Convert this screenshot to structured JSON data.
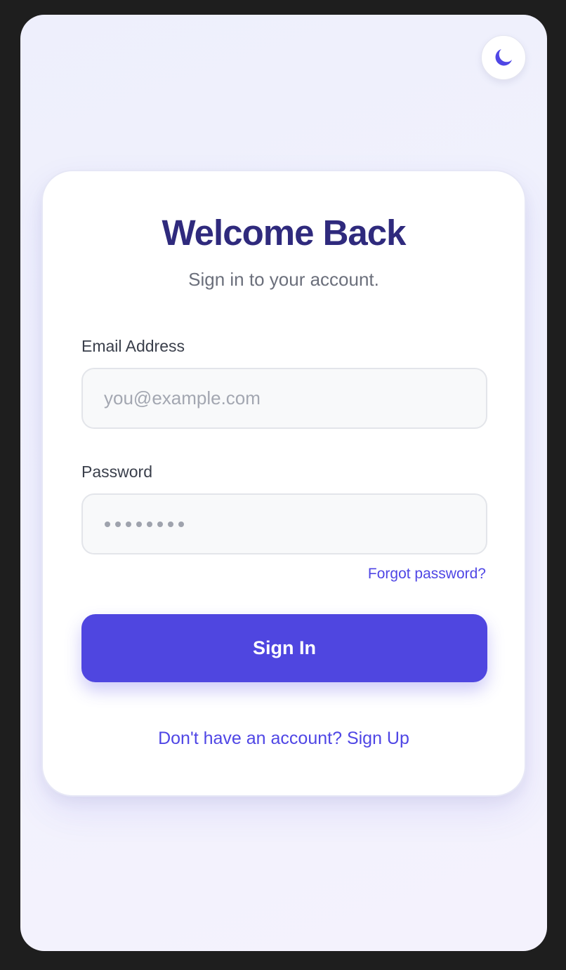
{
  "theme_toggle": {
    "icon": "moon-icon",
    "color": "#4f46e5"
  },
  "card": {
    "title": "Welcome Back",
    "subtitle": "Sign in to your account."
  },
  "email": {
    "label": "Email Address",
    "value": "",
    "placeholder": "you@example.com"
  },
  "password": {
    "label": "Password",
    "masked_value": "••••••••",
    "masked_length": 8
  },
  "forgot_label": "Forgot password?",
  "signin_label": "Sign In",
  "signup_label": "Don't have an account? Sign Up",
  "colors": {
    "accent": "#4f46e5",
    "title": "#2f2a7d",
    "background": "#f1f2fd"
  }
}
